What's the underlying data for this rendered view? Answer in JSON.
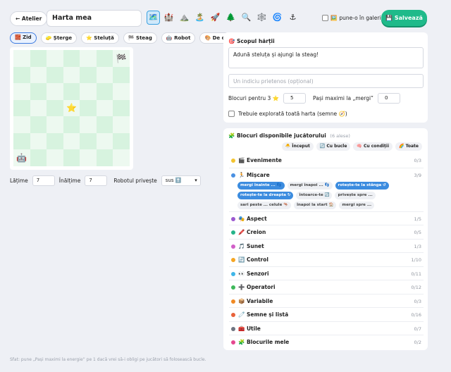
{
  "topbar": {
    "back_label": "← Atelier",
    "map_title": "Harta mea",
    "themes": [
      {
        "icon": "🗺️",
        "name": "map-icon",
        "active": true
      },
      {
        "icon": "🏰",
        "name": "castle-icon"
      },
      {
        "icon": "⛰️",
        "name": "mountain-icon"
      },
      {
        "icon": "🏝️",
        "name": "island-icon"
      },
      {
        "icon": "🚀",
        "name": "rocket-icon"
      },
      {
        "icon": "🌲",
        "name": "tree-icon"
      },
      {
        "icon": "🔍",
        "name": "magnifier-icon"
      },
      {
        "icon": "🕸️",
        "name": "web-icon"
      },
      {
        "icon": "🌀",
        "name": "swirl-icon"
      },
      {
        "icon": "⚓",
        "name": "anchor-icon"
      }
    ],
    "gallery_icon": "🖼️",
    "gallery_label": "pune-o în galerie",
    "save_label": "💾 Salvează"
  },
  "tools": [
    {
      "label": "🧱 Zid",
      "name": "tool-wall",
      "active": true
    },
    {
      "label": "🧽 Șterge",
      "name": "tool-erase"
    },
    {
      "label": "⭐ Steluță",
      "name": "tool-star"
    },
    {
      "label": "🏁 Steag",
      "name": "tool-flag"
    },
    {
      "label": "🤖 Robot",
      "name": "tool-robot"
    },
    {
      "label": "🎨 De colorat",
      "name": "tool-paint"
    }
  ],
  "grid": {
    "rows": 7,
    "cols": 7,
    "items": [
      {
        "row": 0,
        "col": 6,
        "icon": "🏁",
        "name": "flag-icon"
      },
      {
        "row": 3,
        "col": 3,
        "icon": "⭐",
        "name": "star-icon"
      },
      {
        "row": 6,
        "col": 0,
        "icon": "🤖",
        "name": "robot-icon"
      }
    ]
  },
  "size_controls": {
    "width_label": "Lățime",
    "width_value": "7",
    "height_label": "Înălțime",
    "height_value": "7",
    "direction_label": "Robotul privește",
    "direction_value": "sus ⬆️"
  },
  "tip": "Sfat: pune „Pași maximi la energie” pe 1 dacă vrei să-i obligi pe jucători să folosească bucle.",
  "goal": {
    "title": "🎯 Scopul hărții",
    "goal_text": "Adună steluța și ajungi la steag!",
    "hint_placeholder": "Un indiciu prietenos (opțional)",
    "blocks_label": "Blocuri pentru 3 ⭐",
    "blocks_value": "5",
    "steps_label": "Pași maximi la „mergi”",
    "steps_value": "0",
    "explore_label": "Trebuie explorată toată harta (semne 🧭)"
  },
  "blocks_panel": {
    "title": "🧩 Blocuri disponibile jucătorului",
    "selected_count": "(6 alese)",
    "filters": [
      "🐣 Început",
      "🔄 Cu bucle",
      "🧠 Cu condiții",
      "🌈 Toate"
    ],
    "categories": [
      {
        "name": "🎬 Evenimente",
        "count": "0/3",
        "color": "#f3c431"
      },
      {
        "name": "🏃 Mișcare",
        "count": "3/9",
        "color": "#4a90e2",
        "chips": [
          {
            "label": "mergi înainte ... 👣",
            "on": true
          },
          {
            "label": "mergi înapoi ... 👣",
            "on": false
          },
          {
            "label": "rotește-te la stânga ↺",
            "on": true
          },
          {
            "label": "rotește-te la dreapta ↻",
            "on": true
          },
          {
            "label": "întoarce-te 🔄",
            "on": false
          },
          {
            "label": "privește spre ...",
            "on": false
          },
          {
            "label": "sari peste ... celule 🦘",
            "on": false
          },
          {
            "label": "înapoi la start 🏠",
            "on": false
          },
          {
            "label": "mergi spre ...",
            "on": false
          }
        ]
      },
      {
        "name": "🎭 Aspect",
        "count": "1/5",
        "color": "#9b59d0"
      },
      {
        "name": "🖍️ Creion",
        "count": "0/5",
        "color": "#26b38a"
      },
      {
        "name": "🎵 Sunet",
        "count": "1/3",
        "color": "#d15fc8"
      },
      {
        "name": "🔄 Control",
        "count": "1/10",
        "color": "#f5a623"
      },
      {
        "name": "👀 Senzori",
        "count": "0/11",
        "color": "#3fb6e8"
      },
      {
        "name": "➕ Operatori",
        "count": "0/12",
        "color": "#3fb85a"
      },
      {
        "name": "📦 Variabile",
        "count": "0/3",
        "color": "#f08a24"
      },
      {
        "name": "🧷 Semne și listă",
        "count": "0/16",
        "color": "#e8623a"
      },
      {
        "name": "🧰 Utile",
        "count": "0/7",
        "color": "#6e7480"
      },
      {
        "name": "🧩 Blocurile mele",
        "count": "0/2",
        "color": "#e5488f"
      }
    ]
  }
}
